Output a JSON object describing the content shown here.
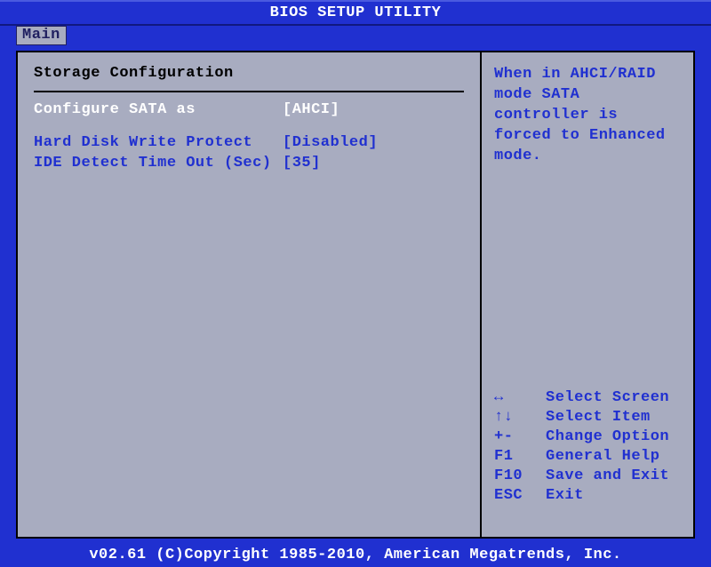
{
  "title": "BIOS SETUP UTILITY",
  "tab": "Main",
  "section_title": "Storage Configuration",
  "options": [
    {
      "label": "Configure SATA as",
      "value": "[AHCI]",
      "selected": true
    },
    {
      "label": "Hard Disk Write Protect",
      "value": "[Disabled]",
      "selected": false
    },
    {
      "label": "IDE Detect Time Out (Sec)",
      "value": "[35]",
      "selected": false
    }
  ],
  "help_text": "When in AHCI/RAID mode SATA controller is forced to Enhanced mode.",
  "nav": [
    {
      "key": "↔",
      "desc": "Select Screen"
    },
    {
      "key": "↑↓",
      "desc": "Select Item"
    },
    {
      "key": "+-",
      "desc": "Change Option"
    },
    {
      "key": "F1",
      "desc": "General Help"
    },
    {
      "key": "F10",
      "desc": "Save and Exit"
    },
    {
      "key": "ESC",
      "desc": "Exit"
    }
  ],
  "footer": "v02.61 (C)Copyright 1985-2010, American Megatrends, Inc."
}
